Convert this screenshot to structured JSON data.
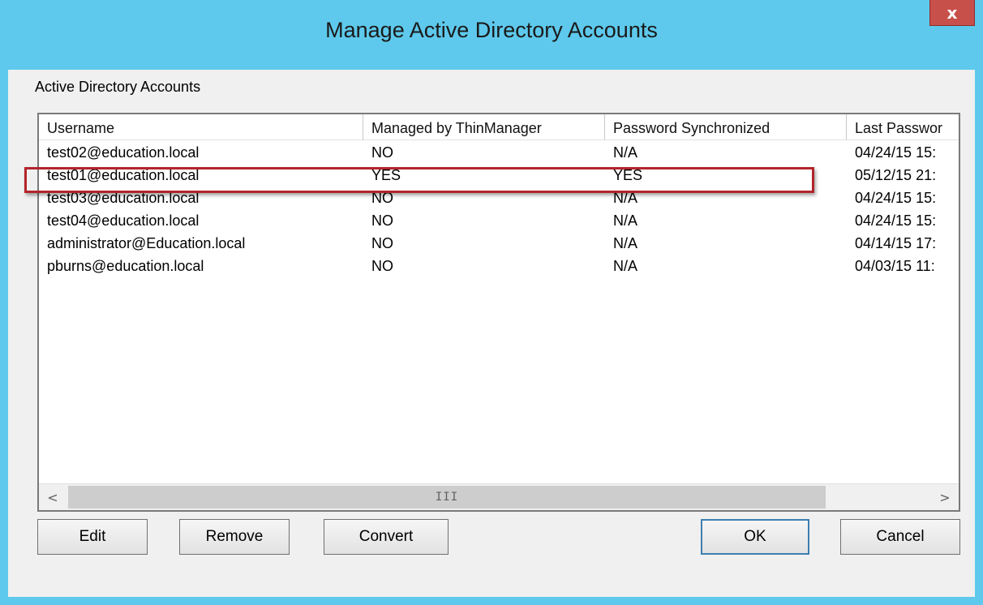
{
  "window": {
    "title": "Manage Active Directory Accounts",
    "close_glyph": "x"
  },
  "group": {
    "label": "Active Directory Accounts"
  },
  "table": {
    "columns": [
      "Username",
      "Managed by ThinManager",
      "Password Synchronized",
      "Last Passwor"
    ],
    "rows": [
      [
        "test02@education.local",
        "NO",
        "N/A",
        "04/24/15 15:"
      ],
      [
        "test01@education.local",
        "YES",
        "YES",
        "05/12/15 21:"
      ],
      [
        "test03@education.local",
        "NO",
        "N/A",
        "04/24/15 15:"
      ],
      [
        "test04@education.local",
        "NO",
        "N/A",
        "04/24/15 15:"
      ],
      [
        "administrator@Education.local",
        "NO",
        "N/A",
        "04/14/15 17:"
      ],
      [
        "pburns@education.local",
        "NO",
        "N/A",
        "04/03/15 11:"
      ]
    ],
    "highlighted_row": 1
  },
  "scrollbar": {
    "left_arrow": "<",
    "right_arrow": ">",
    "grip": "III"
  },
  "buttons": {
    "edit": "Edit",
    "remove": "Remove",
    "convert": "Convert",
    "ok": "OK",
    "cancel": "Cancel"
  },
  "colors": {
    "frame": "#5ec9ec",
    "close_button": "#c7504b",
    "highlight_outline": "#b3242b"
  },
  "icons": {
    "close": "close-icon",
    "scroll_left": "chevron-left-icon",
    "scroll_right": "chevron-right-icon"
  }
}
